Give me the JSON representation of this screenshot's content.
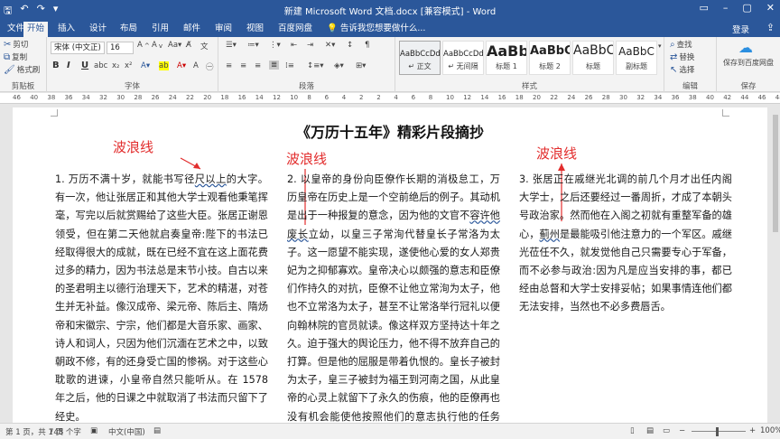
{
  "window": {
    "title": "新建 Microsoft Word 文档.docx [兼容模式] - Word",
    "min_icon": "minimize-icon",
    "max_icon": "maximize-icon",
    "close_icon": "close-icon"
  },
  "quick_access": {
    "save": "🖫",
    "undo": "↶",
    "redo": "↷",
    "customize": "▾"
  },
  "tabs": [
    "文件",
    "开始",
    "插入",
    "设计",
    "布局",
    "引用",
    "邮件",
    "审阅",
    "视图",
    "百度网盘"
  ],
  "tell_me": "告诉我您想要做什么...",
  "login": "登录",
  "share_icon": "share-icon",
  "ribbon": {
    "clipboard": {
      "cut": "剪切",
      "copy": "复制",
      "painter": "格式刷",
      "label": "剪贴板"
    },
    "font": {
      "name": "宋体 (中文正)",
      "size": "16",
      "label": "字体",
      "bold": "B",
      "italic": "I",
      "underline": "U"
    },
    "paragraph": {
      "label": "段落"
    },
    "styles": {
      "label": "样式",
      "items": [
        {
          "sample": "AaBbCcDd",
          "name": "↵ 正文"
        },
        {
          "sample": "AaBbCcDd",
          "name": "↵ 无间隔"
        },
        {
          "sample": "AaBb",
          "name": "标题 1"
        },
        {
          "sample": "AaBbC",
          "name": "标题 2"
        },
        {
          "sample": "AaBbC",
          "name": "标题"
        },
        {
          "sample": "AaBbC",
          "name": "副标题"
        }
      ]
    },
    "editing": {
      "find": "查找",
      "replace": "替换",
      "select": "选择",
      "label": "编辑"
    },
    "save": {
      "button": "保存到百度网盘",
      "label": "保存"
    }
  },
  "ruler": {
    "numbers": [
      "46",
      "40",
      "38",
      "36",
      "34",
      "32",
      "30",
      "28",
      "26",
      "24",
      "22",
      "20",
      "18",
      "16",
      "14",
      "12",
      "10",
      "8",
      "6",
      "4",
      "2",
      "2",
      "4",
      "6",
      "8",
      "10",
      "12",
      "14",
      "16",
      "18",
      "20",
      "22",
      "24",
      "26",
      "28",
      "30",
      "32",
      "34",
      "36",
      "38",
      "40",
      "42",
      "44",
      "46",
      "48"
    ]
  },
  "document": {
    "title": "《万历十五年》精彩片段摘抄",
    "annotations": [
      "波浪线",
      "波浪线",
      "波浪线"
    ],
    "col1": {
      "before": "1. 万历不满十岁，就能书写径",
      "wavy": "尺以上",
      "after": "的大字。有一次，他让张居正和其他大学士观看他秉笔挥毫，写完以后就赏赐给了这些大臣。张居正谢恩领受，但在第二天他就启奏皇帝:陛下的书法已经取得很大的成就，既在已经不宜在这上面花费过多的精力，因为书法总是末节小技。自古以来的圣君明主以德行治理天下，艺术的精湛，对苍生并无补益。像汉成帝、梁元帝、陈后主、隋炀帝和宋徽宗、宁宗，他们都是大音乐家、画家、诗人和词人，只因为他们沉湎在艺术之中，以致朝政不修，有的还身受亡国的惨祸。对于这些心耽歌的进谏，小皇帝自然只能听从。在 1578 年之后，他的日课之中就取消了书法而只留下了经史。"
    },
    "col2": {
      "before": "2. 以皇帝的身份向臣僚作长期的消极怠工，万历皇帝在历史上是一个空前绝后的例子。其动机是出于一种报复的意念，因为他的文官不",
      "wavy": "容许他废长",
      "after": "立幼，以皇三子常洵代替皇长子常洛为太子。这一愿望不能实现，遂使他心爱的女人郑贵妃为之抑郁寡欢。皇帝决心以颇强的意志和臣僚们作持久的对抗，臣僚不让他立常洵为太子，他也不立常洛为太子，甚至不让常洛举行冠礼以便向翰林院的官员就读。像这样双方坚持达十年之久。迫于强大的舆论压力，他不得不放弃自己的打算。但是他的屈服是带着仇恨的。皇长子被封为太子，皇三子被封为福王到河南之国，从此皇帝的心灵上就留下了永久的伤痕，他的臣僚再也没有机会能使他按照他们的意志执行他的任务了。"
    },
    "col3": {
      "before": "3. 张居正在戚继光北调的前几个月才出任内阁大学士，之后还要经过一番周折，才成了本朝头号政治家。然而他在入阁之初就有重整军备的雄心，",
      "wavy": "蓟州",
      "after": "是最能吸引他注意力的一个军区。戚继光莅任不久，就发觉他自己只需要专心于军备，而不必参与政治:因为凡是应当安排的事，都已经由总督和大学士安排妥帖；如果事情连他们都无法安排，当然也不必多费唇舌。"
    }
  },
  "status": {
    "page": "第 1 页，共 1 页",
    "words": "748 个字",
    "lang": "中文(中国)",
    "zoom": "100%"
  },
  "colors": {
    "brand": "#2b579a",
    "annotation": "#e22d2d"
  }
}
